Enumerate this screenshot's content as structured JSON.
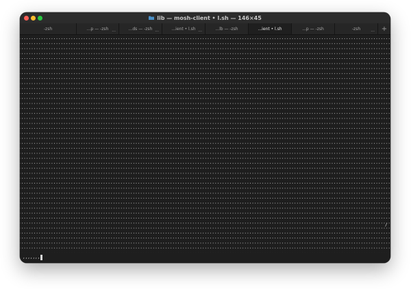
{
  "window": {
    "title": "lib — mosh-client • l.sh — 146×45",
    "title_icon": "folder-icon",
    "folder_color": "#4a90c8"
  },
  "traffic_lights": {
    "close": "#ff5f57",
    "minimize": "#febc2e",
    "zoom": "#28c840"
  },
  "tabs": [
    {
      "label": "-zsh",
      "badge": "",
      "active": false
    },
    {
      "label": "...p — -zsh",
      "badge": "...",
      "active": false
    },
    {
      "label": "...ds — -zsh",
      "badge": "...",
      "active": false
    },
    {
      "label": "...ient • l.sh",
      "badge": "...",
      "active": false
    },
    {
      "label": "...lb — -zsh",
      "badge": "",
      "active": false
    },
    {
      "label": "...ient • l.sh",
      "badge": "",
      "active": true
    },
    {
      "label": "...p — -zsh",
      "badge": "",
      "active": false
    },
    {
      "label": "-zsh",
      "badge": "...",
      "active": false
    }
  ],
  "new_tab_label": "+",
  "terminal": {
    "background": "#1e1e1e",
    "fill_char": ".",
    "prompt_text": ",,,,,,,",
    "right_edge_mark": "/"
  }
}
